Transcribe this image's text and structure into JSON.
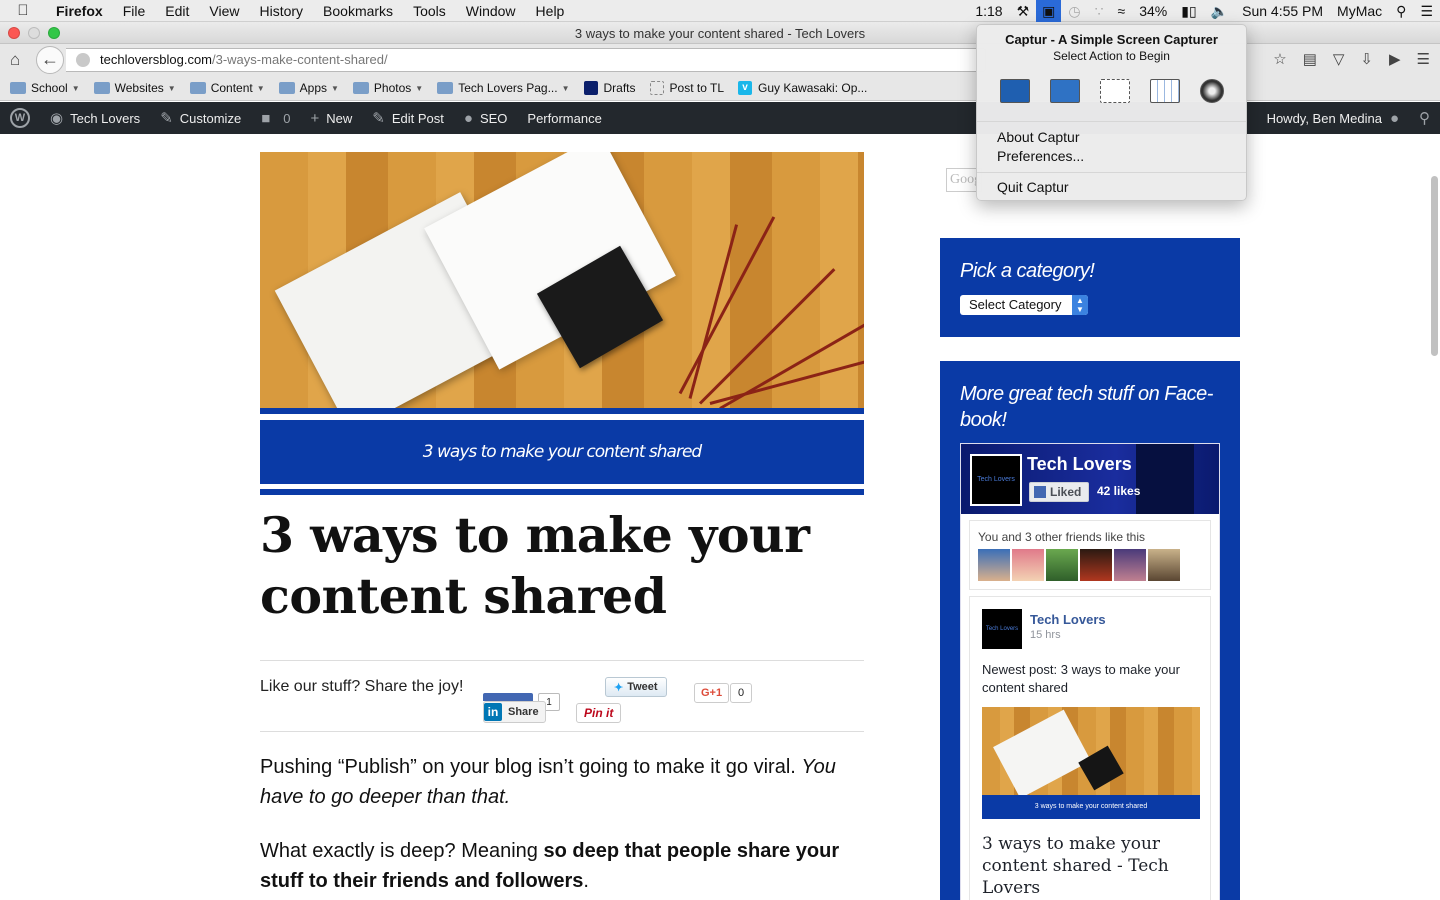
{
  "menubar": {
    "app": "Firefox",
    "items": [
      "File",
      "Edit",
      "View",
      "History",
      "Bookmarks",
      "Tools",
      "Window",
      "Help"
    ],
    "status": {
      "time_small": "1:18",
      "battery": "34%",
      "datetime": "Sun 4:55 PM",
      "computer": "MyMac"
    }
  },
  "window": {
    "title": "3 ways to make your content shared - Tech Lovers"
  },
  "navbar": {
    "url_domain": "techloversblog.com",
    "url_path": "/3-ways-make-content-shared/"
  },
  "bookmarks": [
    {
      "label": "School",
      "type": "folder"
    },
    {
      "label": "Websites",
      "type": "folder"
    },
    {
      "label": "Content",
      "type": "folder"
    },
    {
      "label": "Apps",
      "type": "folder"
    },
    {
      "label": "Photos",
      "type": "folder"
    },
    {
      "label": "Tech Lovers Pag...",
      "type": "folder"
    },
    {
      "label": "Drafts",
      "type": "link"
    },
    {
      "label": "Post to TL",
      "type": "link"
    },
    {
      "label": "Guy Kawasaki: Op...",
      "type": "link"
    }
  ],
  "wpbar": {
    "site": "Tech Lovers",
    "customize": "Customize",
    "comments": "0",
    "new": "New",
    "edit": "Edit Post",
    "seo": "SEO",
    "performance": "Performance",
    "howdy": "Howdy, Ben Medina"
  },
  "post": {
    "banner_text": "3 ways to make your content shared",
    "title": "3 ways to make your content shared",
    "share_label": "Like our stuff? Share the joy!",
    "share": {
      "fb_count": "1",
      "linkedin": "Share",
      "tweet": "Tweet",
      "pinit": "Pin it",
      "gplus": "G+1",
      "gplus_count": "0"
    },
    "p1_a": "Pushing “Publish” on your blog isn’t going to make it go viral. ",
    "p1_b": "You have to go deeper than that.",
    "p2_a": "What exactly is deep? Meaning ",
    "p2_b": "so deep that people share your stuff to their friends and followers",
    "p2_c": "."
  },
  "sidebar": {
    "search_placeholder": "Google",
    "category_title": "Pick a category!",
    "category_select": "Select Category",
    "facebook_title": "More great tech stuff on Face-book!",
    "fb": {
      "page_name": "Tech Lovers",
      "pic_label": "Tech Lovers",
      "liked": "Liked",
      "likes": "42 likes",
      "friends_text": "You and 3 other friends like this",
      "post_name": "Tech Lovers",
      "post_time": "15 hrs",
      "post_text": "Newest post: 3 ways to make your content shared",
      "link_title": "3 ways to make your content shared - Tech Lovers"
    }
  },
  "capture_menu": {
    "title": "Captur - A Simple Screen Capturer",
    "subtitle": "Select Action to Begin",
    "about": "About Captur",
    "preferences": "Preferences...",
    "quit": "Quit Captur"
  },
  "colors": {
    "brand_blue": "#0a3aa6",
    "wp_bar": "#23282d",
    "fb_link": "#365899"
  }
}
